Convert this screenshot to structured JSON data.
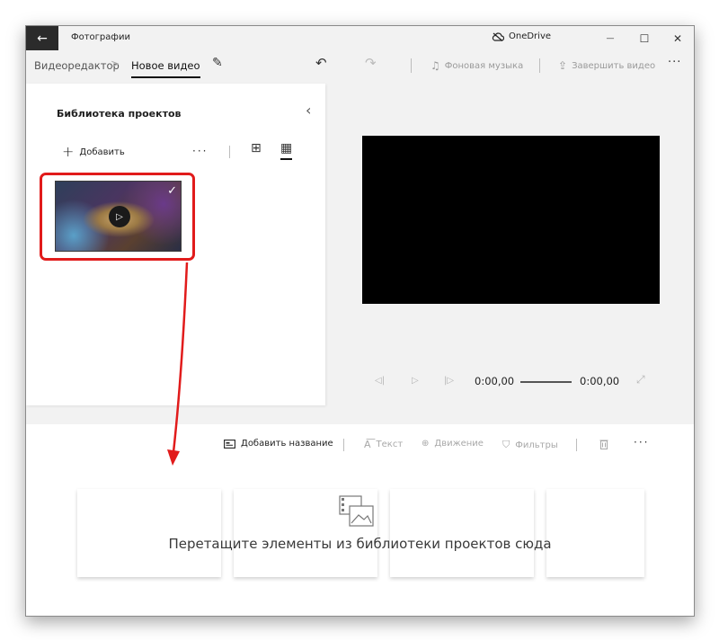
{
  "titlebar": {
    "back_glyph": "←",
    "app_title": "Фотографии",
    "onedrive_label": "OneDrive",
    "onedrive_icon": "cloud-off-icon",
    "minimize_glyph": "—",
    "maximize_glyph": "☐",
    "close_glyph": "✕"
  },
  "commandbar": {
    "breadcrumb_root": "Видеоредактор",
    "breadcrumb_sep": ">",
    "breadcrumb_current": "Новое видео",
    "pencil_glyph": "✎",
    "undo_glyph": "↶",
    "redo_glyph": "↷",
    "music_label": "Фоновая музыка",
    "music_glyph": "♫",
    "finish_label": "Завершить видео",
    "finish_glyph": "⇪",
    "more_glyph": "···"
  },
  "library": {
    "title": "Библиотека проектов",
    "collapse_glyph": "‹",
    "add_plus": "+",
    "add_label": "Добавить",
    "more_glyph": "···",
    "view_grid_large_glyph": "⊞",
    "view_grid_small_glyph": "▦",
    "thumb_play_glyph": "▷",
    "thumb_check_glyph": "✓"
  },
  "player": {
    "prev_glyph": "◁|",
    "play_glyph": "▷",
    "next_glyph": "|▷",
    "current_time": "0:00,00",
    "total_time": "0:00,00",
    "expand_glyph": "⤢"
  },
  "storyboard": {
    "add_title_label": "Добавить название",
    "text_label": "Текст",
    "motion_label": "Движение",
    "filters_label": "Фильтры",
    "trash_glyph": "🗑",
    "more_glyph": "···",
    "drop_hint": "Перетащите элементы из библиотеки проектов сюда"
  },
  "colors": {
    "annotation_red": "#e11b1b",
    "window_bg": "#f2f2f2",
    "panel_bg": "#ffffff",
    "preview_bg": "#000000"
  }
}
